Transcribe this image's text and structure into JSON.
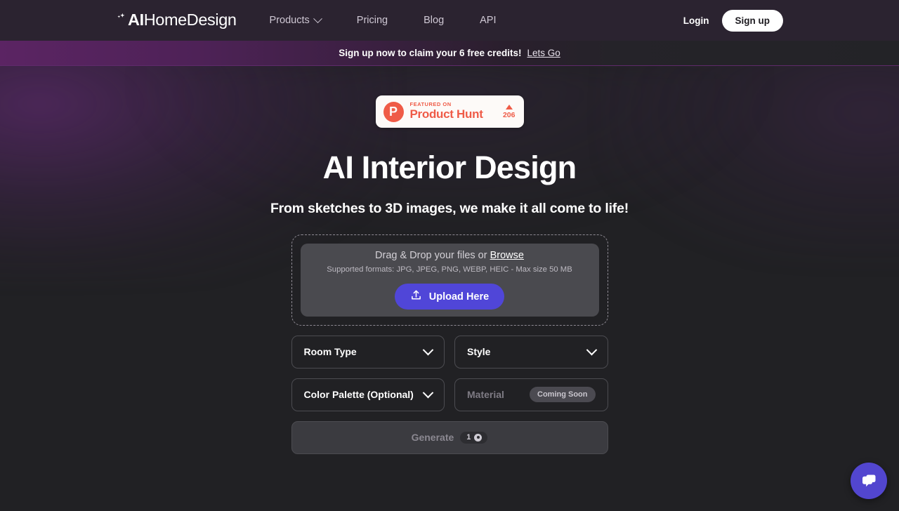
{
  "brand": {
    "name_bold": "AI",
    "name_rest": "HomeDesign",
    "sparkle_icon": "sparkles-icon"
  },
  "nav": {
    "links": [
      {
        "label": "Products",
        "has_caret": true
      },
      {
        "label": "Pricing",
        "has_caret": false
      },
      {
        "label": "Blog",
        "has_caret": false
      },
      {
        "label": "API",
        "has_caret": false
      }
    ],
    "login_label": "Login",
    "signup_label": "Sign up"
  },
  "promo": {
    "text": "Sign up now to claim your 6 free credits!",
    "link_label": "Lets Go",
    "accent_color": "#5f2a6b"
  },
  "product_hunt": {
    "featured_label": "FEATURED ON",
    "name": "Product Hunt",
    "monogram": "P",
    "vote_count": "206",
    "accent_color": "#ef5b47",
    "background_color": "#fdfaf8"
  },
  "hero": {
    "title": "AI Interior Design",
    "subtitle": "From sketches to 3D images, we make it all come to life!"
  },
  "dropzone": {
    "prompt_prefix": "Drag & Drop your files or ",
    "browse_label": "Browse",
    "formats_note": "Supported formats: JPG, JPEG, PNG, WEBP, HEIC - Max size 50 MB",
    "upload_label": "Upload Here",
    "upload_icon": "upload-icon",
    "upload_color": "#5046d8"
  },
  "fields": {
    "room_type": {
      "label": "Room Type",
      "icon": "chevron-down-icon"
    },
    "style": {
      "label": "Style",
      "icon": "chevron-down-icon"
    },
    "color_palette": {
      "label": "Color Palette (Optional)",
      "icon": "chevron-down-icon"
    },
    "material": {
      "label": "Material",
      "badge": "Coming Soon",
      "disabled": true
    }
  },
  "generate": {
    "label": "Generate",
    "credit_cost": "1",
    "credit_icon": "credit-coin-icon",
    "disabled": true
  },
  "chat": {
    "icon": "chat-bubbles-icon",
    "color": "#5246cf"
  }
}
